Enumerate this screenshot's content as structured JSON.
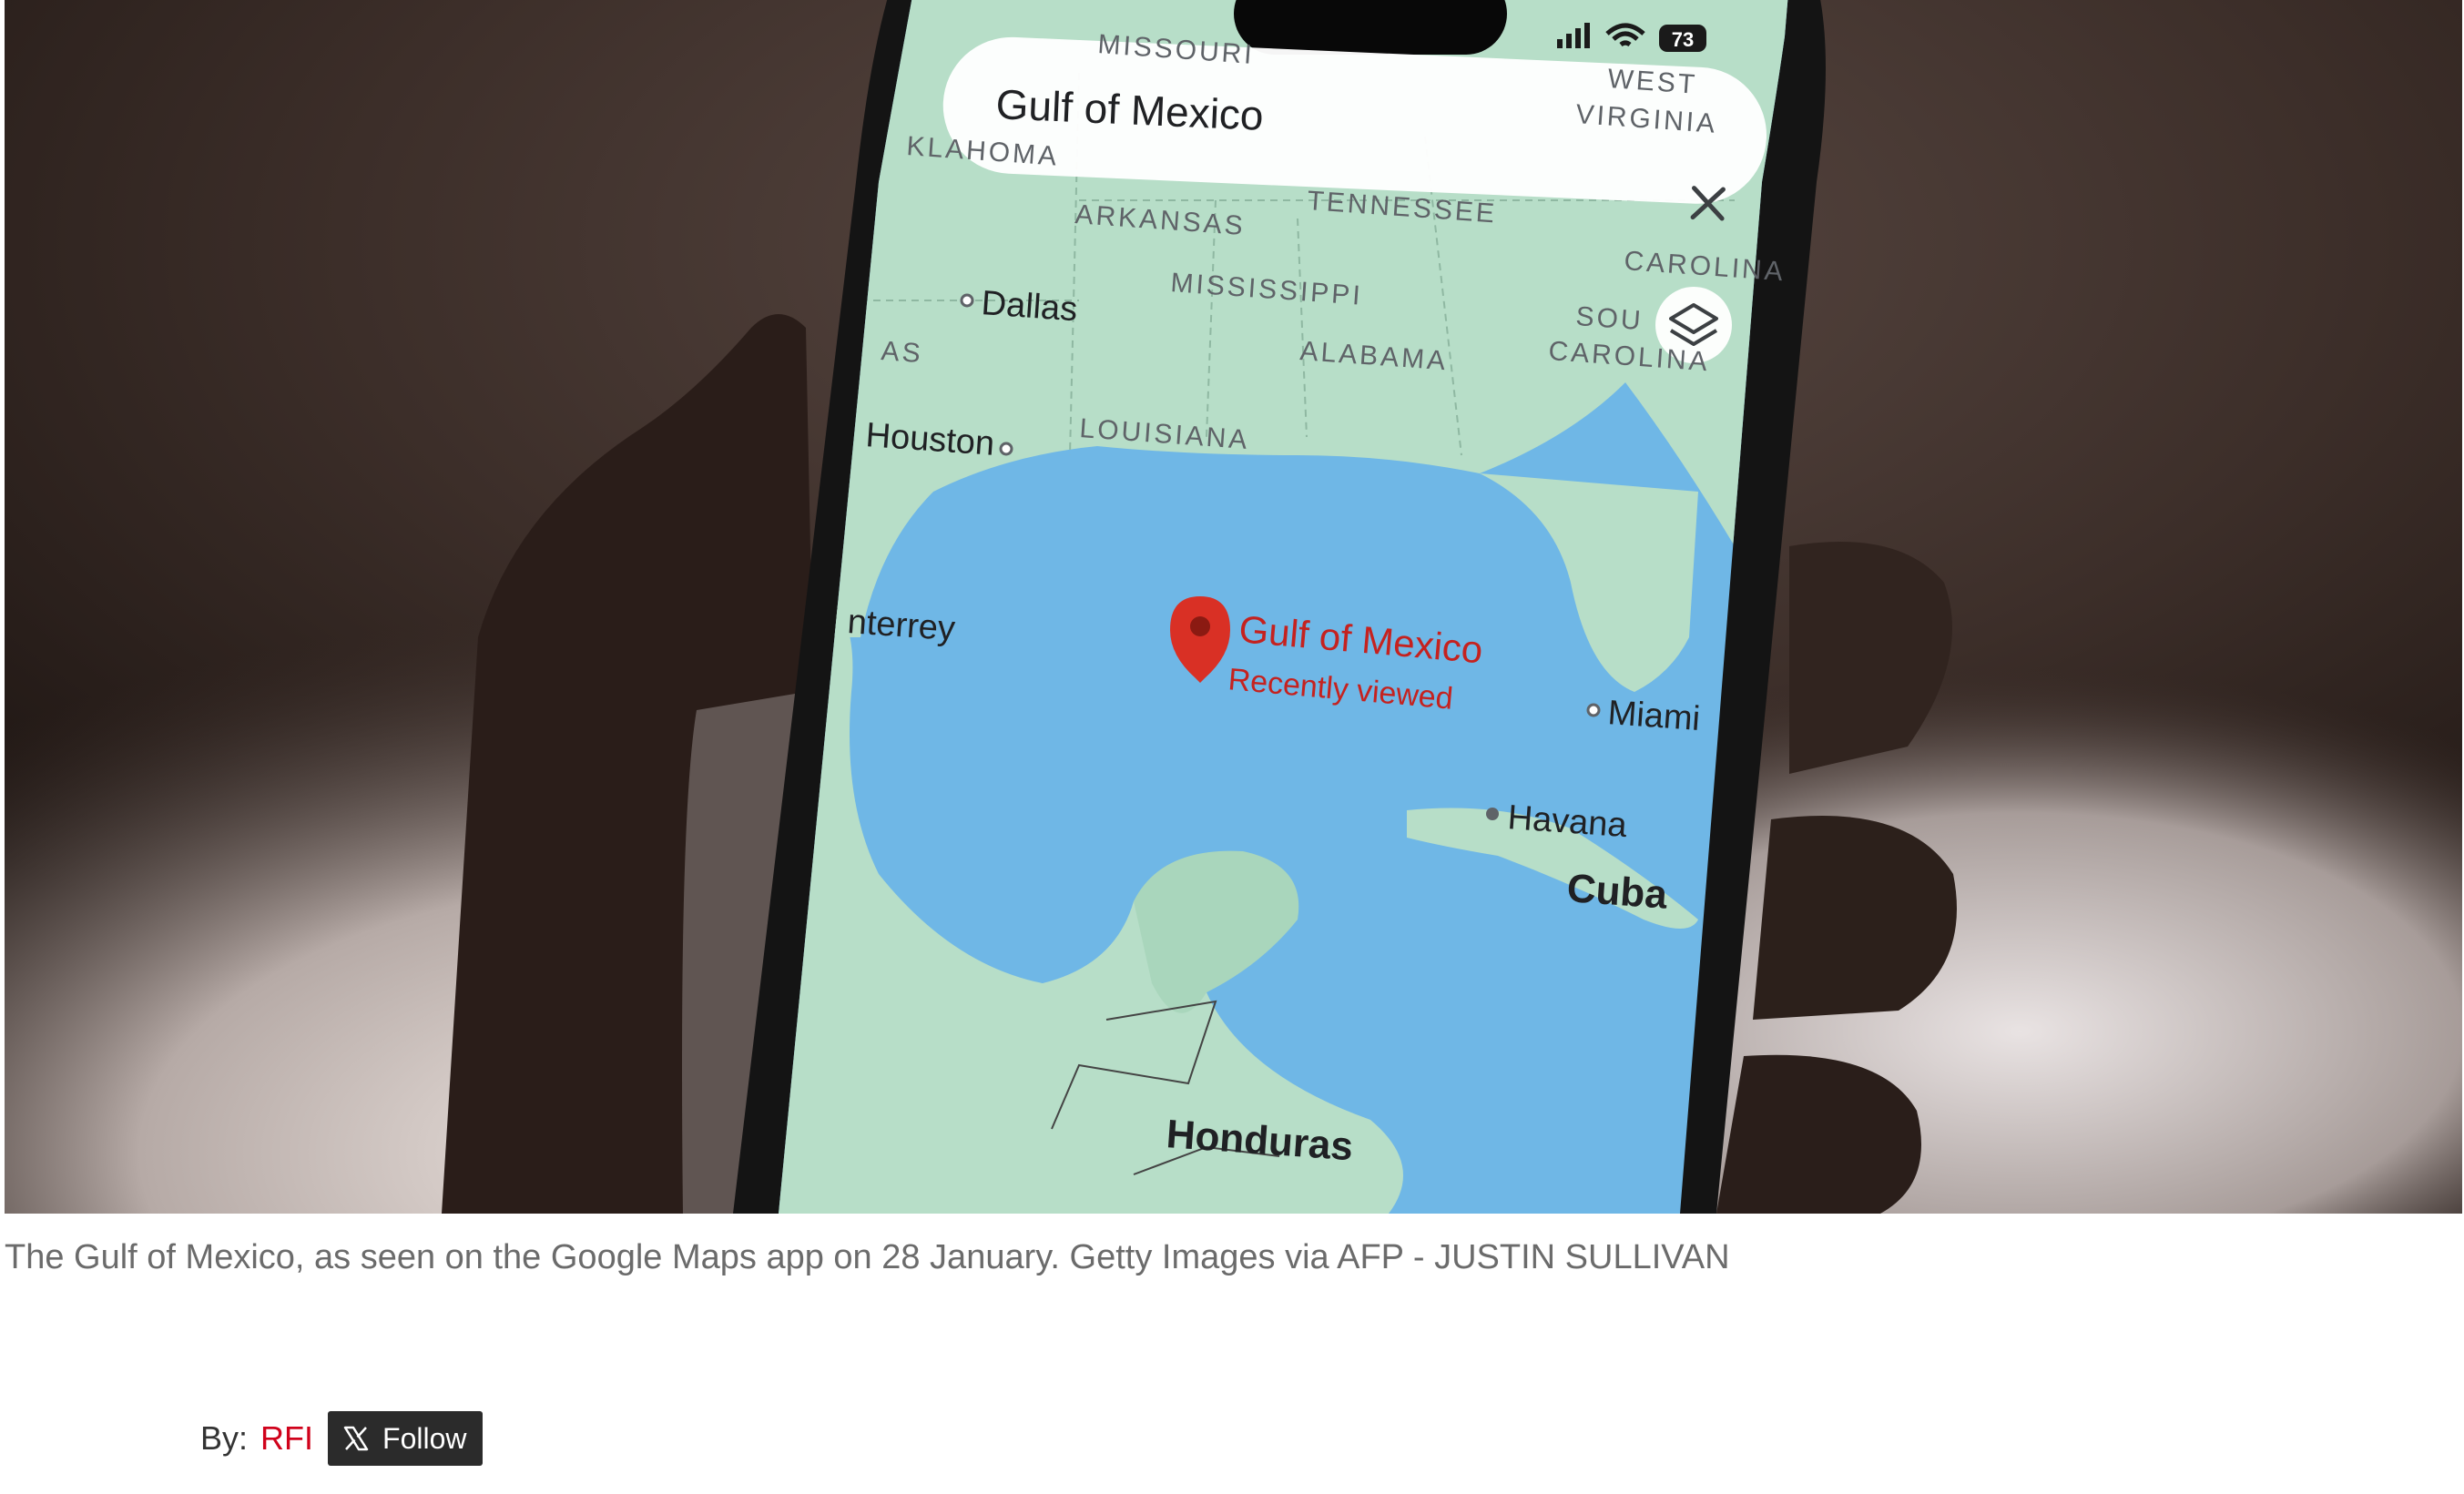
{
  "phone": {
    "battery": "73",
    "search_text": "Gulf of Mexico"
  },
  "map": {
    "labels": {
      "missouri": "MISSOURI",
      "west_virginia_1": "WEST",
      "west_virginia_2": "VIRGINIA",
      "oklahoma": "KLAHOMA",
      "tennessee": "TENNESSEE",
      "arkansas": "ARKANSAS",
      "carolina_n": "CAROLINA",
      "dallas": "Dallas",
      "mississippi": "MISSISSIPPI",
      "alabama": "ALABAMA",
      "sc_1": "SOU",
      "sc_2": "CAROLINA",
      "tx_as": "AS",
      "houston": "Houston",
      "louisiana": "LOUISIANA",
      "monterrey": "nterrey",
      "gulf_pin_title": "Gulf of Mexico",
      "gulf_pin_sub": "Recently viewed",
      "miami": "Miami",
      "havana": "Havana",
      "cuba": "Cuba",
      "honduras": "Honduras"
    }
  },
  "caption": {
    "text": "The Gulf of Mexico, as seen on the Google Maps app on 28 January.  Getty Images via AFP - JUSTIN SULLIVAN"
  },
  "byline": {
    "by_label": "By:",
    "author": "RFI",
    "follow_label": "Follow"
  },
  "colors": {
    "accent_red": "#d0021b",
    "ocean": "#6fb7e6",
    "land": "#b7dec8",
    "pin": "#d93025"
  }
}
